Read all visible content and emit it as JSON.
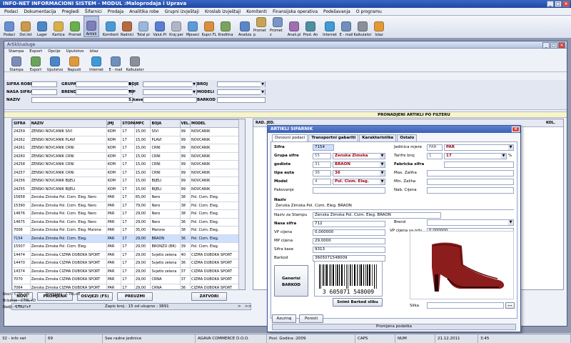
{
  "app": {
    "title": "INFO-NET INFORMACIONI SISTEM    -  MODUL :Maloprodaja i Uprava"
  },
  "menu": [
    "Podaci",
    "Dokumentacija",
    "Pregledi",
    "Šifarnici",
    "Prodaja",
    "Analitika robe",
    "Grupni izvještaji",
    "Kroslab izvještaji",
    "Komitenti",
    "Finansijska operativa",
    "Podešavanja",
    "O programu"
  ],
  "toolbar": [
    {
      "label": "Podaci",
      "color": "#6a8fd0"
    },
    {
      "label": "Dol.list",
      "color": "#c99b4a"
    },
    {
      "label": "Lager",
      "color": "#4f86c6"
    },
    {
      "label": "Kartica",
      "color": "#d8b04b"
    },
    {
      "label": "Promet",
      "color": "#6ab04c"
    },
    {
      "label": "Artikli",
      "color": "#7c7fb8",
      "active": true
    },
    {
      "label": "Komitent",
      "color": "#4a9bd5"
    },
    {
      "label": "Radnici",
      "color": "#b66b3f"
    },
    {
      "label": "Total pr",
      "color": "#9ab7dd"
    },
    {
      "label": "Valut.Pr",
      "color": "#5a7ed1"
    },
    {
      "label": "Kraj per",
      "color": "#b0b6c8"
    },
    {
      "label": "Mjeseci",
      "color": "#5e9ad8"
    },
    {
      "label": "Kupci FL",
      "color": "#d98f3c"
    },
    {
      "label": "Kreditna",
      "color": "#7aa45c"
    },
    {
      "label": "Analiza",
      "color": "#5c86c9"
    },
    {
      "label": "Promet p",
      "color": "#c7a357"
    },
    {
      "label": "Promet z",
      "color": "#7796c4"
    },
    {
      "label": "Anali.pl",
      "color": "#9f6fb1"
    },
    {
      "label": "Prod. An",
      "color": "#4e8f9f"
    },
    {
      "label": "Internet",
      "color": "#3f9ad6"
    },
    {
      "label": "E - mail",
      "color": "#6f8fbd"
    },
    {
      "label": "Kalkulator",
      "color": "#8b8f9c"
    },
    {
      "label": "Izlaz",
      "color": "#e09a3a"
    }
  ],
  "child": {
    "title": "Artikli/usluge",
    "menu": [
      "Stampa",
      "Export",
      "Opcije",
      "Uputstvo",
      "Izlaz"
    ],
    "toolbar": [
      {
        "label": "Stampa",
        "color": "#7a8db8"
      },
      {
        "label": "Export",
        "color": "#6aa45c"
      },
      {
        "label": "Uputstvo",
        "color": "#4a86c9"
      },
      {
        "label": "Napusti",
        "color": "#e09a3a"
      },
      {
        "label": "Internet",
        "color": "#3f9ad6"
      },
      {
        "label": "E - mail",
        "color": "#6f8fbd"
      },
      {
        "label": "Kalkulator",
        "color": "#8b8f9c"
      }
    ],
    "filter": {
      "sifra_robe": "SIFRA ROBE",
      "grupa": "GRUPA",
      "boje": "BOJE",
      "broj": "BROJ",
      "nasa_sifra": "NASA SIFRA",
      "brend": "BREND",
      "tip": "TIP",
      "modeli": "MODELI",
      "naziv": "NAZIV",
      "skase": "S.kase",
      "barkod": "BARKOD"
    },
    "band": "PRONADJENI ARTIKLI PO FILTERU",
    "columns": [
      "SIFRA",
      "NAZIV",
      "JMJ",
      "STOPA",
      "MPC",
      "BOJA",
      "VEL.",
      "MODEL"
    ],
    "rows": [
      [
        "24259",
        "ZENSKI NOVCANIK SIVI",
        "KOM",
        "17",
        "15,00",
        "SIVI",
        "99",
        "NOVCANIK"
      ],
      [
        "24262",
        "ZENSKI NOVCANIK PLAVI",
        "KOM",
        "17",
        "15,00",
        "PLAVI",
        "99",
        "NOVCANIK"
      ],
      [
        "24261",
        "ZENSKI NOVCANIK CRNI",
        "KOM",
        "17",
        "15,00",
        "CRNI",
        "99",
        "NOVCANIK"
      ],
      [
        "24260",
        "ZENSKI NOVCANIK CRNI",
        "KOM",
        "17",
        "15,00",
        "CRNI",
        "99",
        "NOVCANIK"
      ],
      [
        "24258",
        "ZENSKI NOVCANIK CRNI",
        "KOM",
        "17",
        "15,00",
        "CRNI",
        "99",
        "NOVCANIK"
      ],
      [
        "24257",
        "ZENSKI NOVCANIK CRNI",
        "KOM",
        "17",
        "15,00",
        "CRNI",
        "99",
        "NOVCANIK"
      ],
      [
        "24256",
        "ZENSKI NOVCANIK BIJELI",
        "KOM",
        "17",
        "15,00",
        "BIJELI",
        "99",
        "NOVCANIK"
      ],
      [
        "24255",
        "ZENSKI NOVCANIK BIJELI",
        "KOM",
        "17",
        "15,00",
        "BIJELI",
        "99",
        "NOVCANIK"
      ],
      [
        "15658",
        "Zenska Zimska Pol. Cizm. Eleg. Nero",
        "PAR",
        "17",
        "65,00",
        "Nero",
        "38",
        "Pol. Cizm. Eleg."
      ],
      [
        "15390",
        "Zenska Zimska Pol. Cizm. Eleg. Nero",
        "PAR",
        "17",
        "79,00",
        "Nero",
        "38",
        "Pol. Cizm. Eleg."
      ],
      [
        "14676",
        "Zenska Zimska Pol. Cizm. Eleg. Nero",
        "PAR",
        "17",
        "29,00",
        "Nero",
        "38",
        "Pol. Cizm. Eleg."
      ],
      [
        "14675",
        "Zenska Zimska Pol. Cizm. Eleg. Nero",
        "PAR",
        "17",
        "29,00",
        "Nero",
        "36",
        "Pol. Cizm. Eleg."
      ],
      [
        "7006",
        "Zenska Zimska Pol. Cizm. Eleg. Marone",
        "PAR",
        "17",
        "35,00",
        "Marone",
        "38",
        "Pol. Cizm. Eleg."
      ],
      [
        "7154",
        "Zenska Zimska Pol. Cizm. Eleg.",
        "PAR",
        "17",
        "29,00",
        "BRAON",
        "36",
        "Pol. Cizm. Eleg."
      ],
      [
        "15507",
        "Zenska Zimska Pol. Cizm. Eleg.",
        "PAR",
        "17",
        "29,00",
        "BRONZO (BR)",
        "39",
        "Pol. Cizm. Eleg."
      ],
      [
        "14474",
        "Zenska Zimska CIZMA DUBOKA SPORT",
        "PAR",
        "17",
        "29,00",
        "Svjetlo zelena",
        "40",
        "CIZMA DUBOKA SPORT"
      ],
      [
        "14470",
        "Zenska Zimska CIZMA DUBOKA SPORT",
        "PAR",
        "17",
        "29,00",
        "Svjetlo zelena",
        "36",
        "CIZMA DUBOKA SPORT"
      ],
      [
        "14374",
        "Zenska Zimska CIZMA DUBOKA SPORT",
        "PAR",
        "17",
        "29,00",
        "Svjetlo zelena",
        "37",
        "CIZMA DUBOKA SPORT"
      ],
      [
        "7070",
        "Zenska Zimska CIZMA DUBOKA SPORT",
        "PAR",
        "17",
        "29,00",
        "CRNA",
        "37",
        "CIZMA DUBOKA SPORT"
      ],
      [
        "7064",
        "Zenska Zimska CIZMA DUBOKA SPORT",
        "PAR",
        "17",
        "29,00",
        "CRNA",
        "36",
        "CIZMA DUBOKA SPORT"
      ]
    ],
    "selected_row": 13,
    "grid2_cols": [
      "RAD. JED.",
      "KOL."
    ],
    "buttons": {
      "novi": "NOVI",
      "promjena": "PROMJENA",
      "osvjezi": "OSVJEZI (F5)",
      "preuzmi": "PREUZMI",
      "zatvori": "ZATVORI"
    },
    "nav": {
      "first": "<<",
      "prev": "<",
      "status": "Zapis broj : 15 od ukupno : 3891",
      "next": ">",
      "last": ">>"
    },
    "hints": {
      "novi": "Novi  -  CTRL+N",
      "promijeni": "Promijeni  -  CTRL+E",
      "brisanje": "Brisanje   - CTRL+D",
      "nadji": "Nadji   - CTRL +F"
    }
  },
  "dialog": {
    "title": "ARTIKLI SIFARNIK",
    "tabs": [
      "Osnovni podaci",
      "Transportni gabariti",
      "Karakteristike",
      "Ostalo"
    ],
    "fields": {
      "sifra": {
        "label": "Sifra",
        "value": "7154"
      },
      "grupa": {
        "label": "Grupa sifre",
        "code": "55",
        "value": "Zenska Zimska"
      },
      "godiste": {
        "label": "godiste",
        "code": "31",
        "value": "BRAON"
      },
      "tipauta": {
        "label": "tipa auta",
        "code": "36",
        "value": "36"
      },
      "model": {
        "label": "Model",
        "code": "4",
        "value": "Pol. Cizm. Eleg."
      },
      "pakovanje": {
        "label": "Pakovanje",
        "value": ""
      },
      "jm": {
        "label": "Jedinica mjere",
        "code": "PAR",
        "value": "PAR"
      },
      "tarifni": {
        "label": "Tarifni broj",
        "code": "1",
        "value": "17",
        "unit": "%"
      },
      "fabricka": {
        "label": "Fabricka sifra",
        "value": ""
      },
      "maxz": {
        "label": "Max. Zaliha",
        "value": ""
      },
      "minz": {
        "label": "Min. Zaliha",
        "value": ""
      },
      "nabc": {
        "label": "Nab. Cijena",
        "value": ""
      },
      "naziv": {
        "label": "Naziv",
        "value": "Zenska Zimska Pol. Cizm. Eleg. BRAON"
      },
      "naziv_st": {
        "label": "Naziv za Stampu",
        "value": "Zenska Zimska Pol. Cizm. Eleg. BRAON"
      },
      "nasa": {
        "label": "Nasa sifra",
        "value": "712"
      },
      "brend": {
        "label": "Brend",
        "value": ""
      },
      "vp": {
        "label": "VP cijena",
        "value": "0,000000"
      },
      "vppdv": {
        "label": "VP cijena sa pdv",
        "value": "0,000000"
      },
      "mp": {
        "label": "MP cijena",
        "value": "29,0000"
      },
      "skase": {
        "label": "Sifra kase",
        "value": "9313"
      },
      "barkod": {
        "label": "Barkod",
        "value": "3605071548009"
      }
    },
    "barcode_text": "3 605071 548009",
    "gen_btn": "Generisi BARKOD",
    "snimi_btn": "Snimi Barkod sliku",
    "slika": "Slika",
    "slika_btn": "...",
    "azuriraj": "Azuriraj",
    "ponisti": "Ponisti",
    "status": "Promjena podatka"
  },
  "statusbar": [
    "32 - info net",
    "69",
    "See radne jedinice",
    "AGAVA COMMERCE D.O.O.",
    "Posl. Godina :2009",
    "CAPS",
    "NUM",
    "21.12.2011",
    "3:45"
  ]
}
